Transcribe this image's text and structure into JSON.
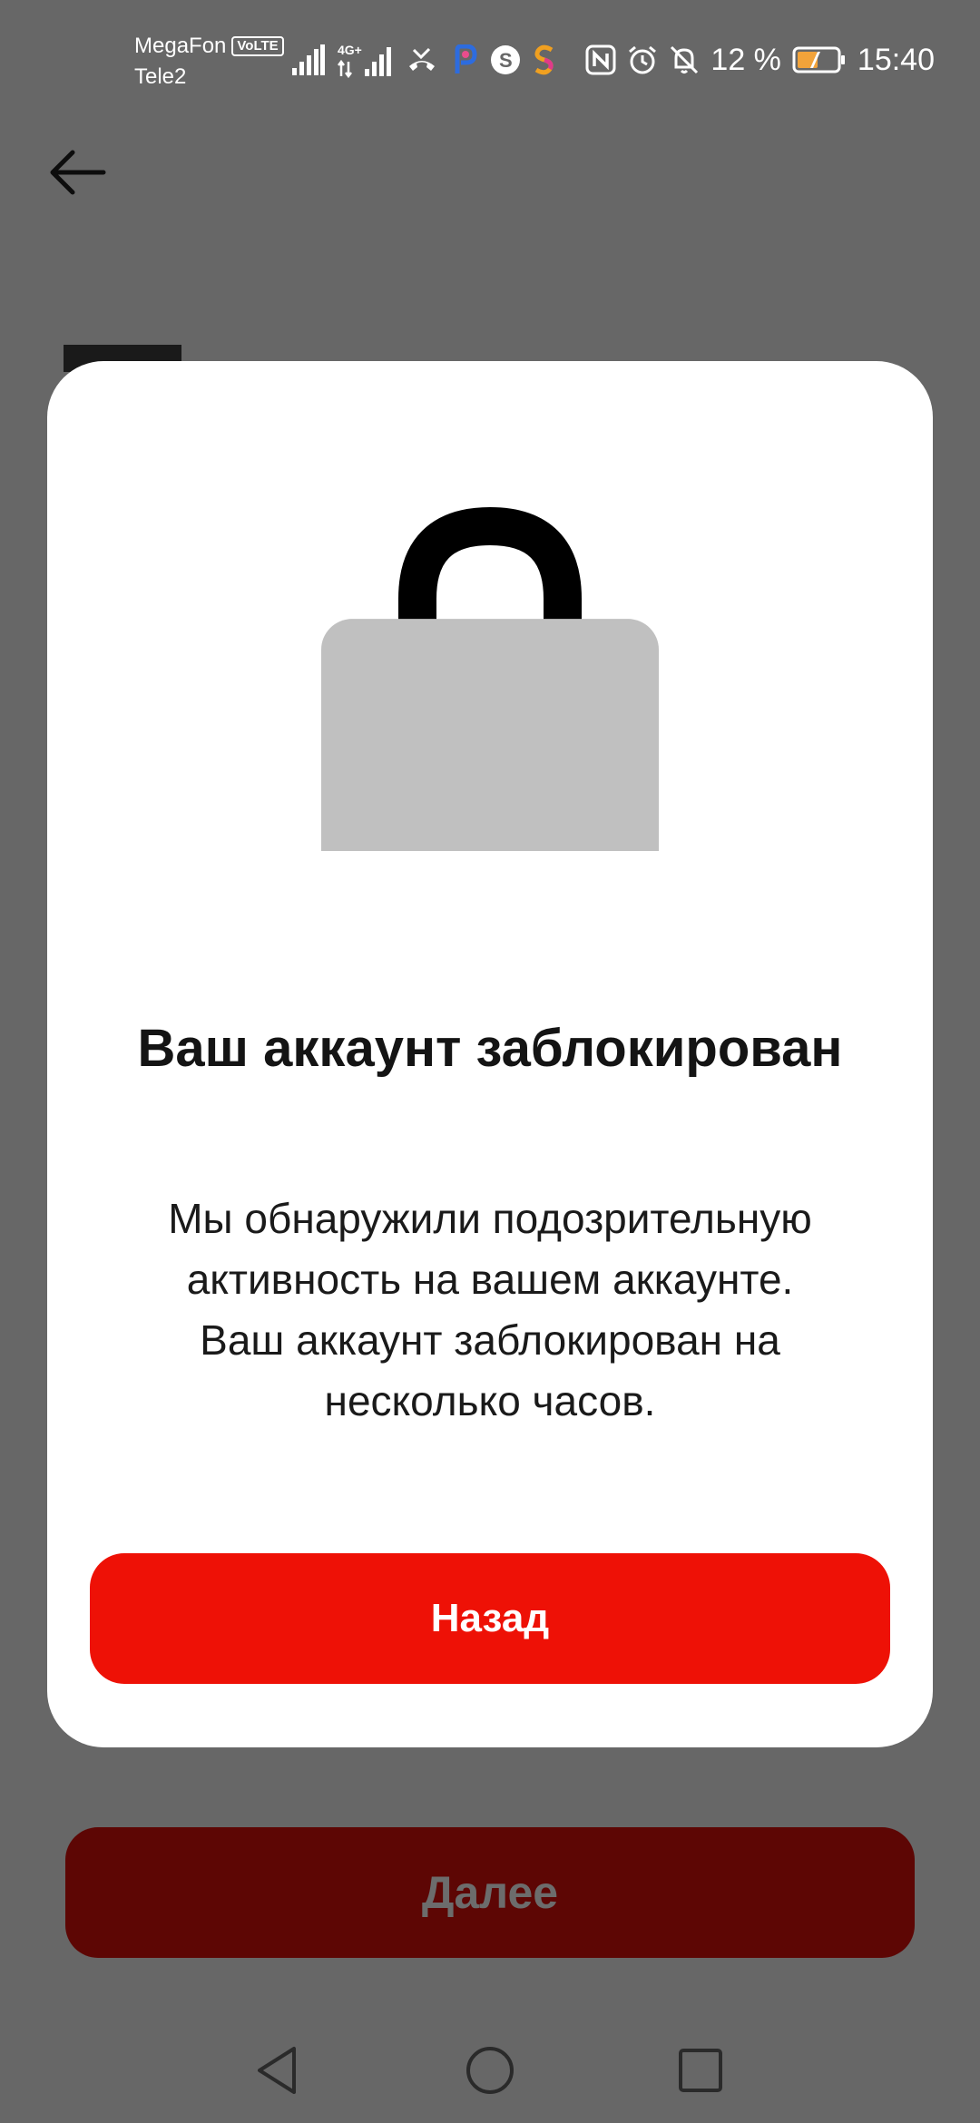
{
  "status_bar": {
    "carrier_primary": "MegaFon",
    "carrier_badge": "VoLTE",
    "carrier_secondary": "Tele2",
    "network_label": "4G+",
    "battery_percent": "12 %",
    "time": "15:40",
    "icons_left": [
      "signal-bars-icon",
      "4g-signal-icon",
      "missed-call-icon",
      "p-app-icon",
      "s-app-icon",
      "s-colored-app-icon"
    ],
    "icons_right": [
      "nfc-icon",
      "alarm-icon",
      "bell-off-icon",
      "battery-icon"
    ]
  },
  "header": {
    "back_icon": "arrow-left-icon"
  },
  "dialog": {
    "icon": "lock-icon",
    "title": "Ваш аккаунт заблокирован",
    "body": "Мы обнаружили подозрительную активность на вашем аккаунте. Ваш аккаунт заблокирован на несколько часов.",
    "button_label": "Назад"
  },
  "background": {
    "next_button_label": "Далее"
  },
  "nav": {
    "icons": [
      "back-triangle-icon",
      "home-circle-icon",
      "recents-square-icon"
    ]
  },
  "colors": {
    "overlay": "#676767",
    "accent_red": "#ee1106",
    "dimmed_red": "#5d0604",
    "lock_body": "#c0c0c0"
  }
}
